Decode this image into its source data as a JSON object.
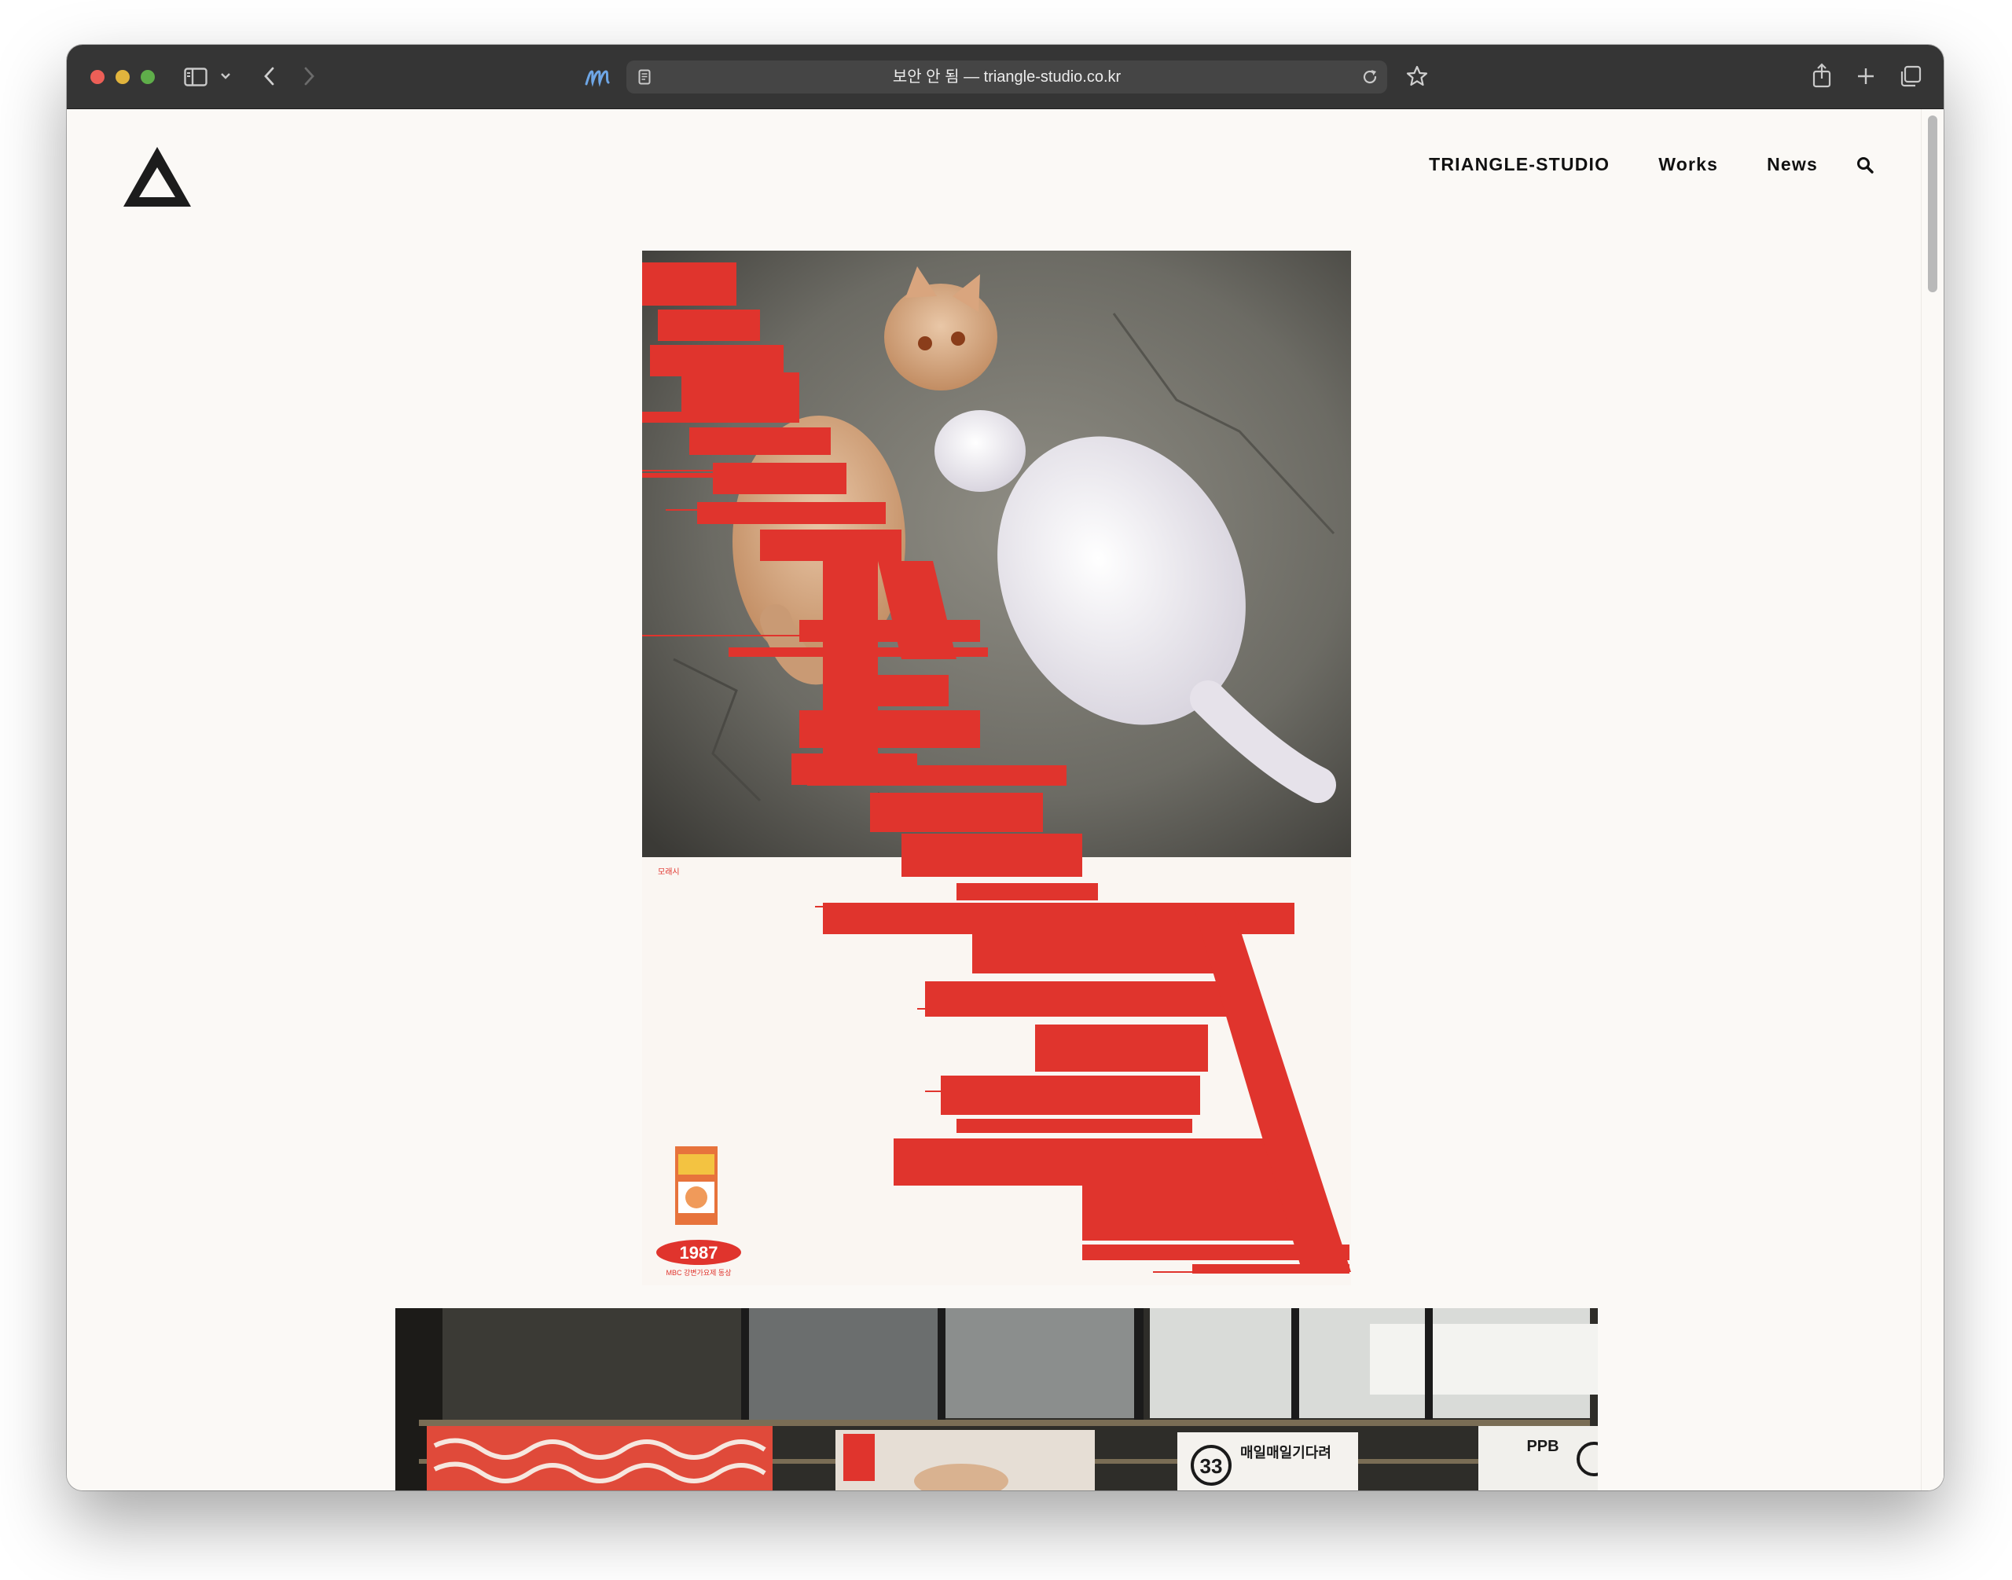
{
  "browser": {
    "address_text": "보안 안 됨 — triangle-studio.co.kr",
    "colors": {
      "titlebar": "#353535",
      "address_bg": "#454545"
    }
  },
  "site": {
    "nav": [
      {
        "label": "TRIANGLE-STUDIO"
      },
      {
        "label": "Works"
      },
      {
        "label": "News"
      }
    ],
    "icons": [
      "triangle-logo-icon",
      "search-icon"
    ]
  },
  "poster": {
    "colors": {
      "red": "#e0342d",
      "paper": "#faf6f2"
    },
    "credit_small": "모래시",
    "badge_year": "1987",
    "badge_caption": "MBC 강변가요제 동상"
  },
  "photo2": {
    "number": "33",
    "label": "매일매일기다려",
    "right_sign": "PPB"
  }
}
